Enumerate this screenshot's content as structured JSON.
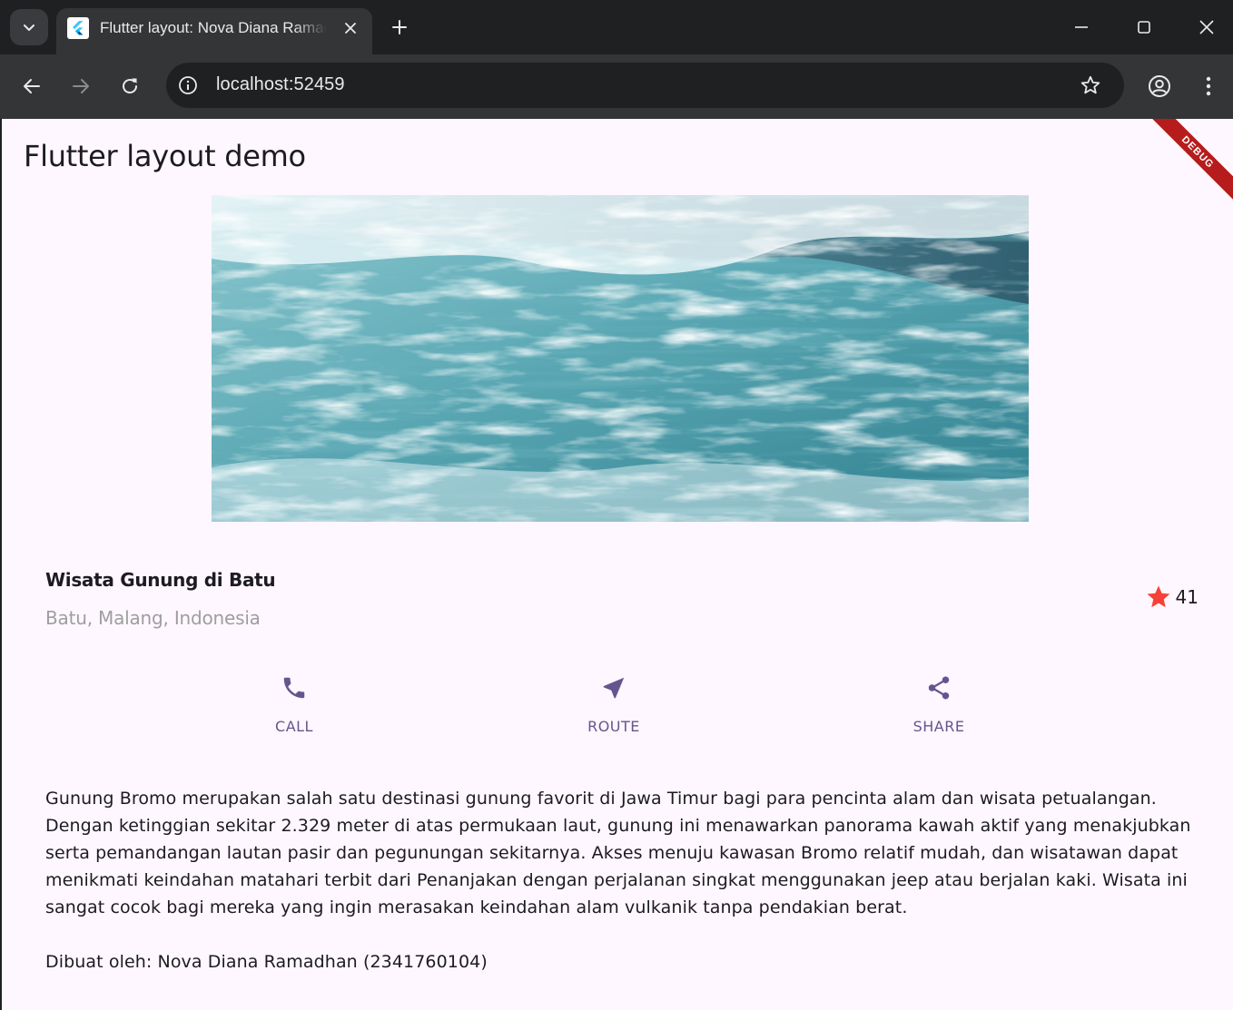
{
  "browser": {
    "tab_title": "Flutter layout: Nova Diana Ramadhan",
    "url": "localhost:52459"
  },
  "app": {
    "title": "Flutter layout demo",
    "debug_banner": "DEBUG",
    "colors": {
      "primary": "#65558f",
      "star": "#f44336",
      "background": "#fef7ff"
    }
  },
  "place": {
    "name": "Wisata Gunung di Batu",
    "location": "Batu, Malang, Indonesia",
    "rating_count": "41"
  },
  "actions": [
    {
      "label": "CALL",
      "icon": "phone-icon"
    },
    {
      "label": "ROUTE",
      "icon": "near-me-icon"
    },
    {
      "label": "SHARE",
      "icon": "share-icon"
    }
  ],
  "description": "Gunung Bromo merupakan salah satu destinasi gunung favorit di Jawa Timur bagi para pencinta alam dan wisata petualangan. Dengan ketinggian sekitar 2.329 meter di atas permukaan laut, gunung ini menawarkan panorama kawah aktif yang menakjubkan serta pemandangan lautan pasir dan pegunungan sekitarnya. Akses menuju kawasan Bromo relatif mudah, dan wisatawan dapat menikmati keindahan matahari terbit dari Penanjakan dengan perjalanan singkat menggunakan jeep atau berjalan kaki. Wisata ini sangat cocok bagi mereka yang ingin merasakan keindahan alam vulkanik tanpa pendakian berat.",
  "credit": "Dibuat oleh: Nova Diana Ramadhan (2341760104)"
}
